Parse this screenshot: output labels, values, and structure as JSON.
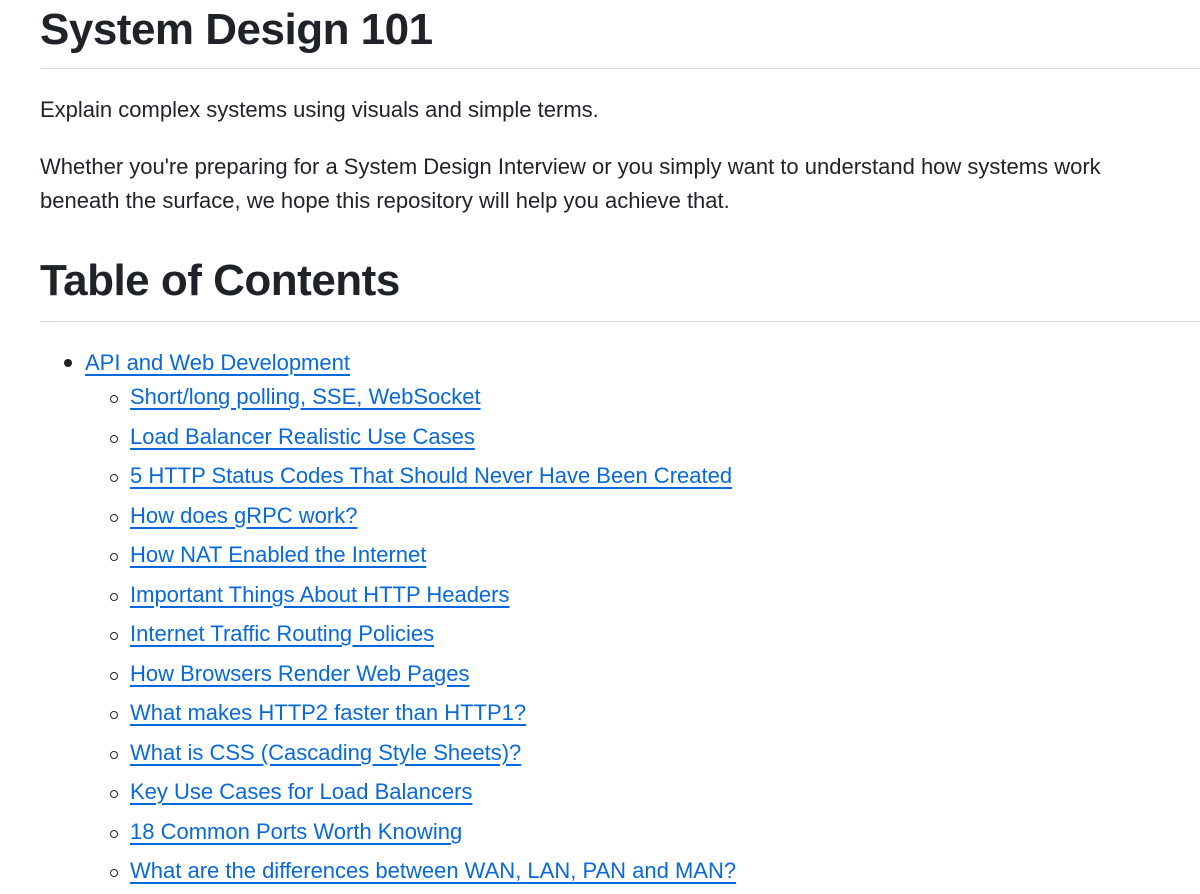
{
  "title": "System Design 101",
  "intro": "Explain complex systems using visuals and simple terms.",
  "description": "Whether you're preparing for a System Design Interview or you simply want to understand how systems work beneath the surface, we hope this repository will help you achieve that.",
  "toc_heading": "Table of Contents",
  "toc": {
    "section": "API and Web Development",
    "items": [
      "Short/long polling, SSE, WebSocket",
      "Load Balancer Realistic Use Cases",
      "5 HTTP Status Codes That Should Never Have Been Created",
      "How does gRPC work?",
      "How NAT Enabled the Internet",
      "Important Things About HTTP Headers",
      "Internet Traffic Routing Policies",
      "How Browsers Render Web Pages",
      "What makes HTTP2 faster than HTTP1?",
      "What is CSS (Cascading Style Sheets)?",
      "Key Use Cases for Load Balancers",
      "18 Common Ports Worth Knowing",
      "What are the differences between WAN, LAN, PAN and MAN?"
    ]
  },
  "colors": {
    "link": "#0969da",
    "text": "#1f2328",
    "divider": "#d8dee4"
  }
}
